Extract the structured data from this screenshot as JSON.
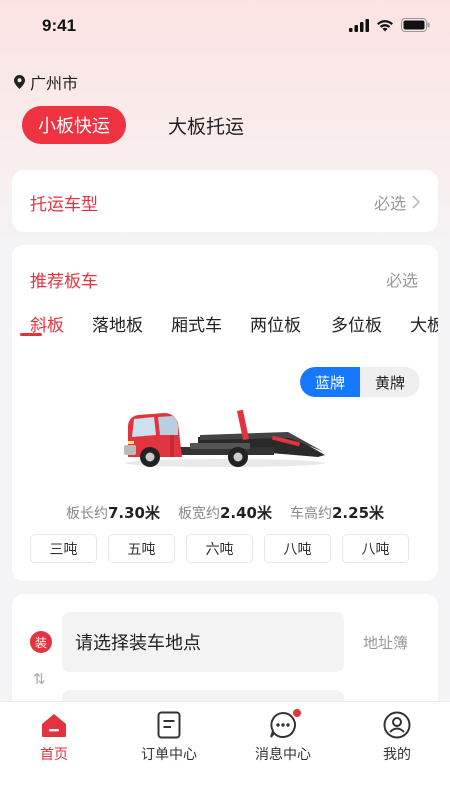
{
  "status_bar": {
    "time": "9:41"
  },
  "location": {
    "city": "广州市"
  },
  "mode_tabs": [
    {
      "label": "小板快运",
      "active": true
    },
    {
      "label": "大板托运",
      "active": false
    }
  ],
  "vehicle_type": {
    "title": "托运车型",
    "required": "必选"
  },
  "recommend": {
    "title": "推荐板车",
    "required": "必选",
    "tabs": [
      "斜板",
      "落地板",
      "厢式车",
      "两位板",
      "多位板",
      "大板"
    ],
    "active_tab": 0,
    "plate": {
      "options": [
        "蓝牌",
        "黄牌"
      ],
      "selected": "蓝牌"
    },
    "specs": [
      {
        "label": "板长约",
        "value": "7.30米"
      },
      {
        "label": "板宽约",
        "value": "2.40米"
      },
      {
        "label": "车高约",
        "value": "2.25米"
      }
    ],
    "tonnage": [
      "三吨",
      "五吨",
      "六吨",
      "八吨",
      "八吨"
    ]
  },
  "address": {
    "load_badge": "装",
    "load_placeholder": "请选择装车地点",
    "address_book": "地址簿"
  },
  "bottom_nav": [
    {
      "label": "首页",
      "icon": "home-icon",
      "active": true
    },
    {
      "label": "订单中心",
      "icon": "order-icon",
      "active": false
    },
    {
      "label": "消息中心",
      "icon": "message-icon",
      "active": false,
      "badge": true
    },
    {
      "label": "我的",
      "icon": "profile-icon",
      "active": false
    }
  ],
  "colors": {
    "accent": "#e2343f",
    "blue": "#1677ff"
  }
}
